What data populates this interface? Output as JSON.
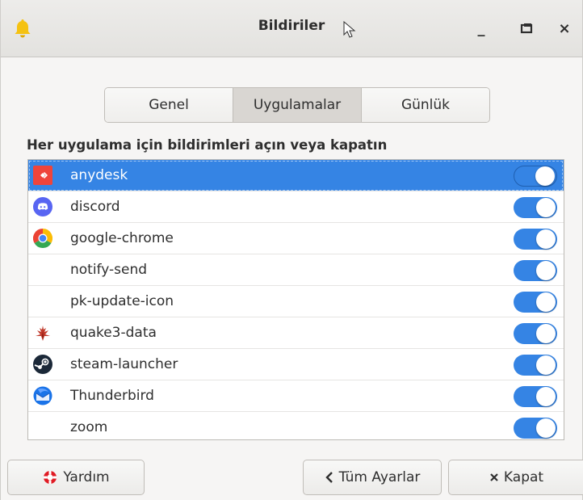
{
  "window": {
    "title": "Bildiriler",
    "controls": {
      "minimize": "_",
      "close": "×"
    }
  },
  "tabs": [
    {
      "label": "Genel",
      "active": false
    },
    {
      "label": "Uygulamalar",
      "active": true
    },
    {
      "label": "Günlük",
      "active": false
    }
  ],
  "heading": "Her uygulama için bildirimleri açın veya kapatın",
  "apps": [
    {
      "name": "anydesk",
      "icon": "anydesk-icon",
      "enabled": true,
      "selected": true
    },
    {
      "name": "discord",
      "icon": "discord-icon",
      "enabled": true
    },
    {
      "name": "google-chrome",
      "icon": "chrome-icon",
      "enabled": true
    },
    {
      "name": "notify-send",
      "icon": "",
      "enabled": true
    },
    {
      "name": "pk-update-icon",
      "icon": "",
      "enabled": true
    },
    {
      "name": "quake3-data",
      "icon": "quake-icon",
      "enabled": true
    },
    {
      "name": "steam-launcher",
      "icon": "steam-icon",
      "enabled": true
    },
    {
      "name": "Thunderbird",
      "icon": "thunderbird-icon",
      "enabled": true
    },
    {
      "name": "zoom",
      "icon": "",
      "enabled": true
    }
  ],
  "buttons": {
    "help": "Yardım",
    "all_settings": "Tüm Ayarlar",
    "close": "Kapat"
  },
  "colors": {
    "accent": "#3584e4",
    "bell": "#f5c211"
  }
}
